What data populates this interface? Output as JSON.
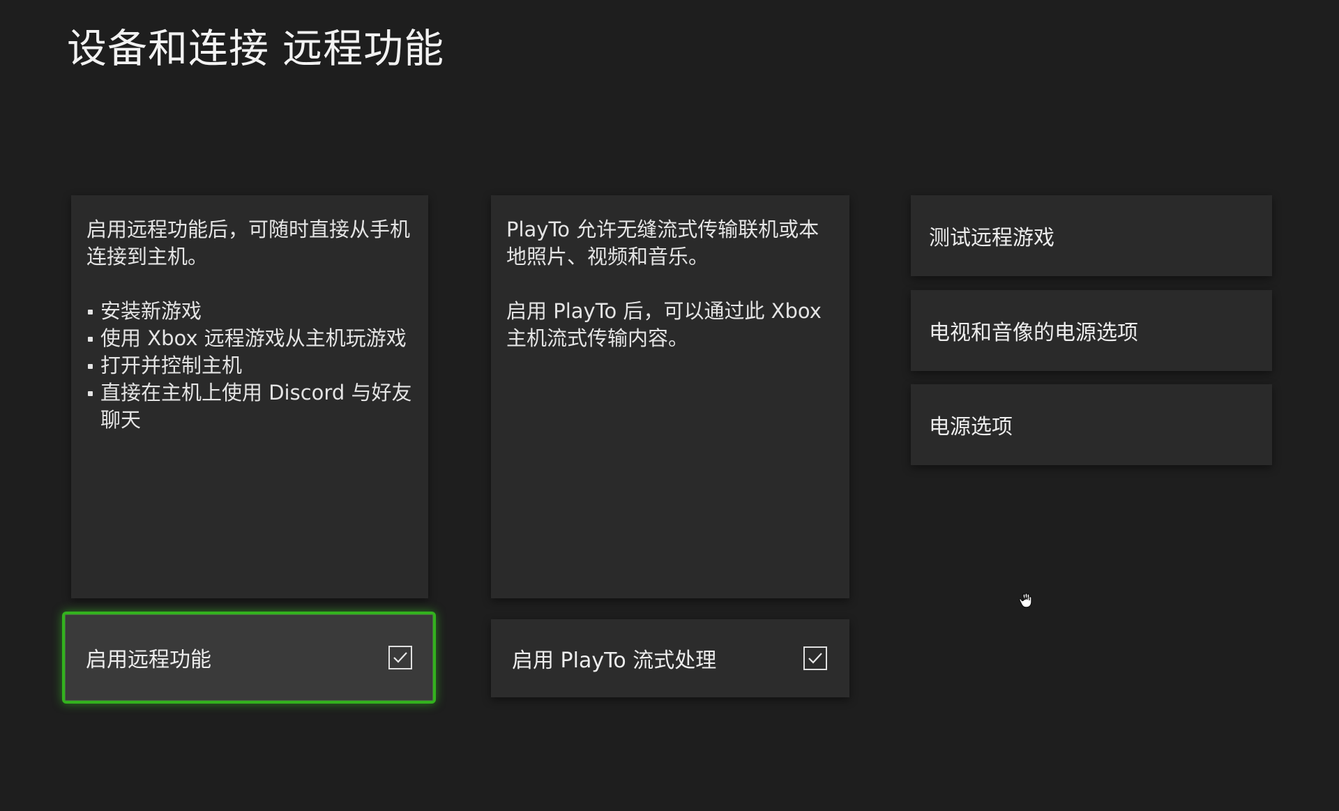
{
  "header": {
    "title": "设备和连接 远程功能"
  },
  "remote_panel": {
    "description": "启用远程功能后，可随时直接从手机连接到主机。",
    "bullets": [
      "安装新游戏",
      "使用 Xbox 远程游戏从主机玩游戏",
      "打开并控制主机",
      "直接在主机上使用 Discord 与好友聊天"
    ],
    "toggle_label": "启用远程功能",
    "toggle_checked": true
  },
  "playto_panel": {
    "description_1": "PlayTo 允许无缝流式传输联机或本地照片、视频和音乐。",
    "description_2": "启用 PlayTo 后，可以通过此 Xbox 主机流式传输内容。",
    "toggle_label": "启用 PlayTo 流式处理",
    "toggle_checked": true
  },
  "side_menu": {
    "items": [
      {
        "label": "测试远程游戏"
      },
      {
        "label": "电视和音像的电源选项"
      },
      {
        "label": "电源选项"
      }
    ]
  },
  "colors": {
    "background": "#1e1e1e",
    "panel": "#2a2a2a",
    "focus_outline": "#33b21e"
  },
  "icons": {
    "checkbox": "checkbox-checked-icon",
    "cursor": "hand-cursor-icon"
  }
}
